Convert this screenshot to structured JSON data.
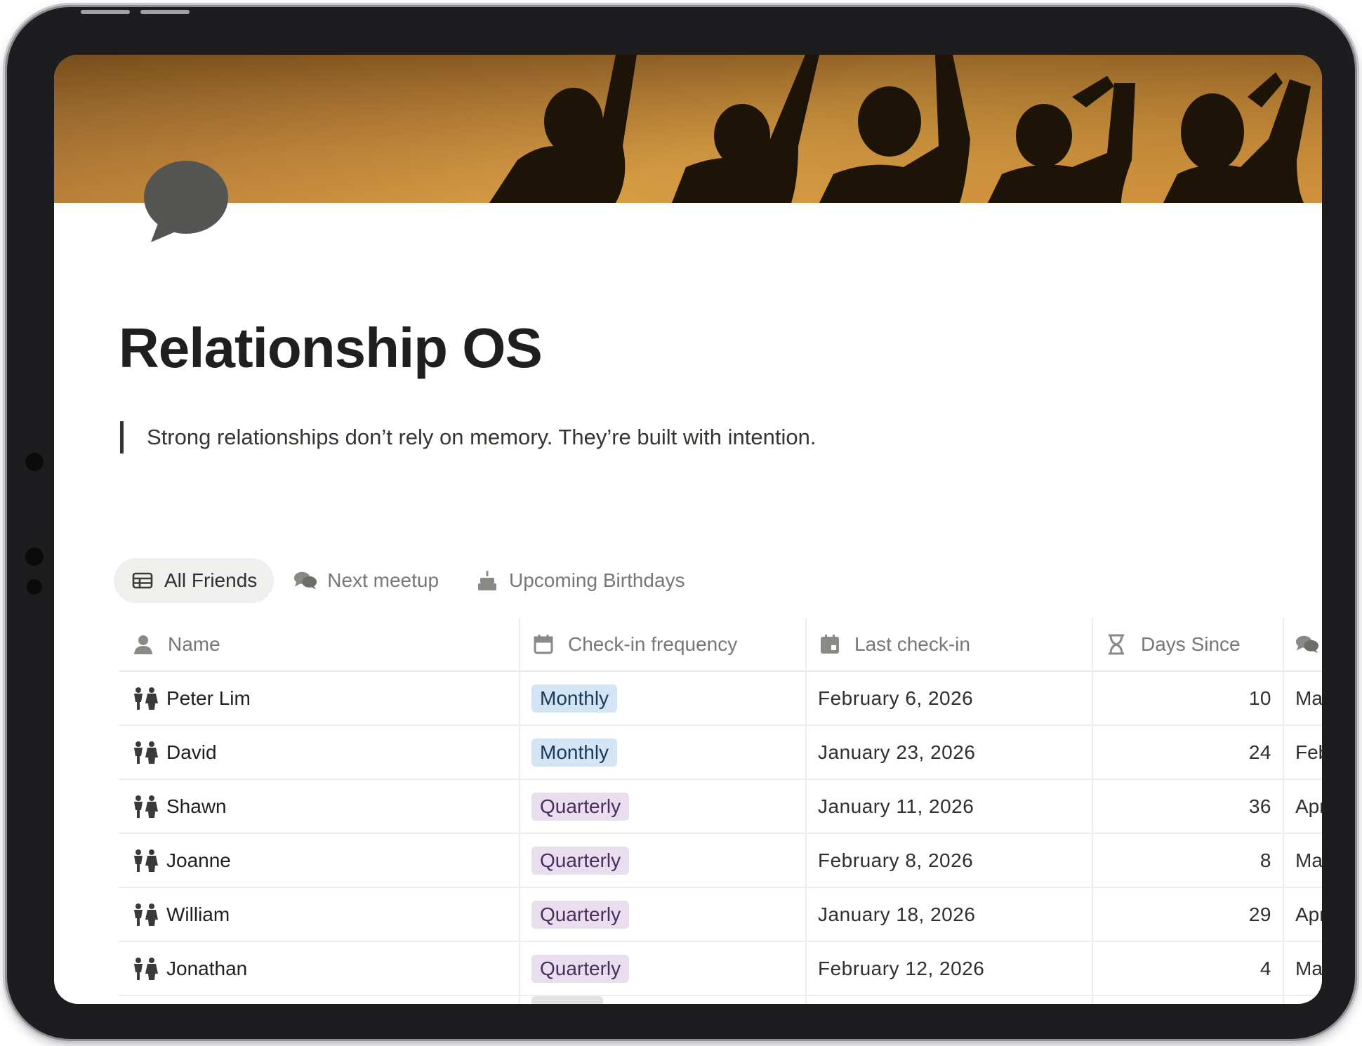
{
  "page": {
    "title": "Relationship OS",
    "quote": "Strong relationships don’t rely on memory. They’re built with intention.",
    "page_icon": "speech-bubble-icon",
    "cover": "silhouette-friends-sunset-cover"
  },
  "tabs": [
    {
      "label": "All Friends",
      "icon": "table-icon",
      "active": true
    },
    {
      "label": "Next meetup",
      "icon": "chat-bubbles-icon",
      "active": false
    },
    {
      "label": "Upcoming Birthdays",
      "icon": "cake-icon",
      "active": false
    }
  ],
  "table": {
    "columns": [
      {
        "label": "Name",
        "icon": "person-icon"
      },
      {
        "label": "Check-in frequency",
        "icon": "calendar-icon"
      },
      {
        "label": "Last check-in",
        "icon": "calendar-event-icon"
      },
      {
        "label": "Days Since",
        "icon": "hourglass-icon"
      },
      {
        "label": "",
        "icon": "chat-bubbles-icon"
      }
    ],
    "rows": [
      {
        "name": "Peter Lim",
        "frequency": "Monthly",
        "last_checkin": "February 6, 2026",
        "days_since": "10",
        "next": "Ma"
      },
      {
        "name": "David",
        "frequency": "Monthly",
        "last_checkin": "January 23, 2026",
        "days_since": "24",
        "next": "Feb"
      },
      {
        "name": "Shawn",
        "frequency": "Quarterly",
        "last_checkin": "January 11, 2026",
        "days_since": "36",
        "next": "Apr"
      },
      {
        "name": "Joanne",
        "frequency": "Quarterly",
        "last_checkin": "February 8, 2026",
        "days_since": "8",
        "next": "Ma"
      },
      {
        "name": "William",
        "frequency": "Quarterly",
        "last_checkin": "January 18, 2026",
        "days_since": "29",
        "next": "Apr"
      },
      {
        "name": "Jonathan",
        "frequency": "Quarterly",
        "last_checkin": "February 12, 2026",
        "days_since": "4",
        "next": "Ma"
      }
    ]
  },
  "colors": {
    "monthly_bg": "#d3e5f5",
    "quarterly_bg": "#e8deee",
    "active_tab_bg": "#efefee"
  }
}
